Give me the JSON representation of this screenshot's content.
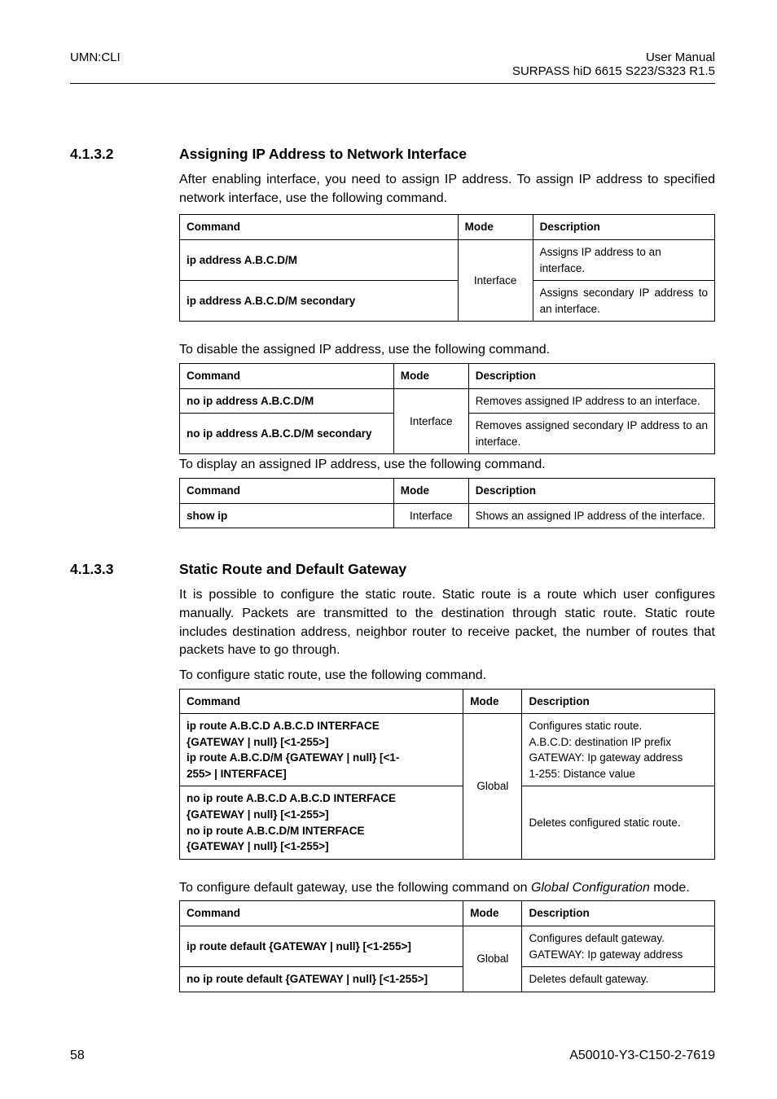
{
  "header": {
    "left": "UMN:CLI",
    "right_line1": "User Manual",
    "right_line2": "SURPASS hiD 6615 S223/S323 R1.5"
  },
  "section": {
    "number": "4.1.3.2",
    "title": "Assigning IP Address to Network Interface"
  },
  "intro_para": "After enabling interface, you need to assign IP address. To assign IP address to specified network interface, use the following command.",
  "table1": {
    "headers": {
      "c1": "Command",
      "c2": "Mode",
      "c3": "Description"
    },
    "mode": "Interface",
    "rows": [
      {
        "cmd": "ip address A.B.C.D/M",
        "desc": "Assigns IP address to an interface."
      },
      {
        "cmd": "ip address A.B.C.D/M secondary",
        "desc": "Assigns secondary IP address to an interface."
      }
    ]
  },
  "disable_para": "To disable the assigned IP address, use the following command.",
  "table2": {
    "headers": {
      "c1": "Command",
      "c2": "Mode",
      "c3": "Description"
    },
    "mode": "Interface",
    "rows": [
      {
        "cmd": "no ip address A.B.C.D/M",
        "desc": "Removes assigned IP address to an interface."
      },
      {
        "cmd": "no ip address A.B.C.D/M secondary",
        "desc": "Removes assigned secondary IP address to an interface."
      }
    ]
  },
  "display_para": "To display an assigned IP address, use the following command.",
  "table3": {
    "headers": {
      "c1": "Command",
      "c2": "Mode",
      "c3": "Description"
    },
    "row": {
      "cmd": "show ip",
      "mode": "Interface",
      "desc": "Shows an assigned IP address of the interface."
    }
  },
  "section2": {
    "number": "4.1.3.3",
    "title": "Static Route and Default Gateway"
  },
  "static_para": "It is possible to configure the static route. Static route is a route which user configures manually. Packets are transmitted to the destination through static route. Static route includes destination address, neighbor router to receive packet, the number of routes that packets have to go through.",
  "static_para2": "To configure static route, use the following command.",
  "table4": {
    "headers": {
      "c1": "Command",
      "c2": "Mode",
      "c3": "Description"
    },
    "mode": "Global",
    "rows": [
      {
        "cmd_lines": [
          "ip route A.B.C.D A.B.C.D INTERFACE",
          "{GATEWAY | null} [<1-255>]",
          "ip route A.B.C.D/M {GATEWAY | null} [<1-",
          "255> | INTERFACE]"
        ],
        "desc_lines": [
          "Configures static route.",
          "A.B.C.D: destination IP prefix",
          "GATEWAY: Ip gateway address",
          "1-255: Distance value"
        ]
      },
      {
        "cmd_lines": [
          "no ip route A.B.C.D A.B.C.D INTERFACE",
          "{GATEWAY | null} [<1-255>]",
          "no ip route A.B.C.D/M INTERFACE",
          "{GATEWAY | null} [<1-255>]"
        ],
        "desc": "Deletes configured static route."
      }
    ]
  },
  "gateway_para_pre": "To configure default gateway, use the following command on ",
  "gateway_para_mid": "Global Configuration",
  "gateway_para_post": " mode.",
  "table5": {
    "headers": {
      "c1": "Command",
      "c2": "Mode",
      "c3": "Description"
    },
    "mode": "Global",
    "rows": [
      {
        "cmd": "ip route default {GATEWAY | null} [<1-255>]",
        "desc_lines": [
          "Configures default gateway.",
          "GATEWAY: Ip gateway address"
        ]
      },
      {
        "cmd": "no ip route default {GATEWAY | null} [<1-255>]",
        "desc": "Deletes default gateway."
      }
    ]
  },
  "footer": {
    "left": "58",
    "right": "A50010-Y3-C150-2-7619"
  }
}
